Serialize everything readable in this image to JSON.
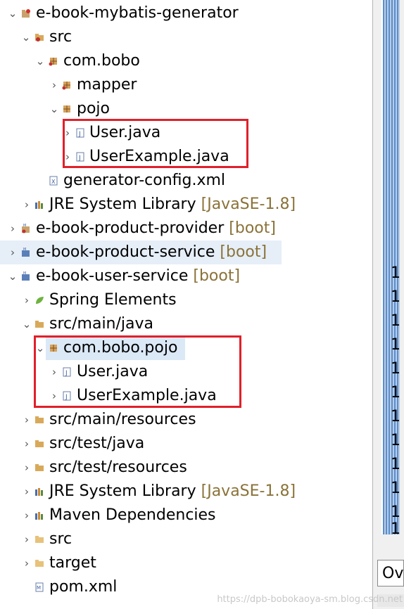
{
  "tree": {
    "rows": [
      {
        "label": "e-book-mybatis-generator",
        "decoration": "",
        "icon": "project-icon",
        "expander": "expanded"
      },
      {
        "label": "src",
        "decoration": "",
        "icon": "source-folder-icon",
        "expander": "expanded"
      },
      {
        "label": "com.bobo",
        "decoration": "",
        "icon": "package-icon",
        "expander": "expanded"
      },
      {
        "label": "mapper",
        "decoration": "",
        "icon": "package-icon",
        "expander": "collapsed"
      },
      {
        "label": "pojo",
        "decoration": "",
        "icon": "package-icon",
        "expander": "expanded"
      },
      {
        "label": "User.java",
        "decoration": "",
        "icon": "java-file-icon",
        "expander": "collapsed"
      },
      {
        "label": "UserExample.java",
        "decoration": "",
        "icon": "java-file-icon",
        "expander": "collapsed"
      },
      {
        "label": "generator-config.xml",
        "decoration": "",
        "icon": "xml-file-icon",
        "expander": "none"
      },
      {
        "label": "JRE System Library",
        "decoration": "[JavaSE-1.8]",
        "icon": "library-icon",
        "expander": "collapsed"
      },
      {
        "label": "e-book-product-provider",
        "decoration": "[boot]",
        "icon": "maven-project-icon",
        "expander": "collapsed"
      },
      {
        "label": "e-book-product-service",
        "decoration": "[boot]",
        "icon": "maven-project-icon",
        "expander": "collapsed"
      },
      {
        "label": "e-book-user-service",
        "decoration": "[boot]",
        "icon": "maven-project-icon",
        "expander": "expanded"
      },
      {
        "label": "Spring Elements",
        "decoration": "",
        "icon": "spring-leaf-icon",
        "expander": "collapsed"
      },
      {
        "label": "src/main/java",
        "decoration": "",
        "icon": "source-folder-icon",
        "expander": "expanded"
      },
      {
        "label": "com.bobo.pojo",
        "decoration": "",
        "icon": "package-icon",
        "expander": "expanded"
      },
      {
        "label": "User.java",
        "decoration": "",
        "icon": "java-file-icon",
        "expander": "collapsed"
      },
      {
        "label": "UserExample.java",
        "decoration": "",
        "icon": "java-file-icon",
        "expander": "collapsed"
      },
      {
        "label": "src/main/resources",
        "decoration": "",
        "icon": "source-folder-icon",
        "expander": "collapsed"
      },
      {
        "label": "src/test/java",
        "decoration": "",
        "icon": "source-folder-icon",
        "expander": "collapsed"
      },
      {
        "label": "src/test/resources",
        "decoration": "",
        "icon": "source-folder-icon",
        "expander": "collapsed"
      },
      {
        "label": "JRE System Library",
        "decoration": "[JavaSE-1.8]",
        "icon": "library-icon",
        "expander": "collapsed"
      },
      {
        "label": "Maven Dependencies",
        "decoration": "",
        "icon": "library-icon",
        "expander": "collapsed"
      },
      {
        "label": "src",
        "decoration": "",
        "icon": "folder-icon",
        "expander": "collapsed"
      },
      {
        "label": "target",
        "decoration": "",
        "icon": "folder-icon",
        "expander": "collapsed"
      },
      {
        "label": "pom.xml",
        "decoration": "",
        "icon": "maven-pom-icon",
        "expander": "none"
      }
    ]
  },
  "right_pane": {
    "line_numbers": [
      "1",
      "1",
      "1",
      "1",
      "1",
      "1",
      "1",
      "1",
      "1",
      "1",
      "1",
      "1"
    ],
    "overview_tab": "Ov"
  },
  "watermark": "https://dpb-bobokaoya-sm.blog.csdn.net",
  "colors": {
    "highlight_box": "#e0202a",
    "selection": "#dbe8f6",
    "decoration": "#8a7238"
  }
}
